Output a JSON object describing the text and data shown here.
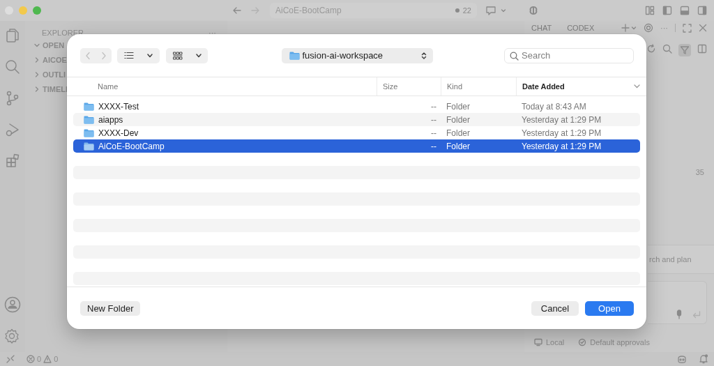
{
  "window": {
    "title": "AiCoE-BootCamp",
    "changes_count": "22"
  },
  "explorer": {
    "title": "EXPLORER",
    "more": "···",
    "sections": [
      {
        "label": "OPEN",
        "expanded": true
      },
      {
        "label": "AICOE",
        "expanded": false
      },
      {
        "label": "OUTLI",
        "expanded": false
      },
      {
        "label": "TIMELI",
        "expanded": false
      }
    ]
  },
  "chat_panel": {
    "tabs": [
      "CHAT",
      "CODEX"
    ],
    "more": "···",
    "filter_active": true,
    "line_count": "35",
    "suggestion": "rch and plan",
    "footer": [
      {
        "kind": "local",
        "label": "Local"
      },
      {
        "kind": "approvals",
        "label": "Default approvals"
      }
    ]
  },
  "status_bar": {
    "errors": "0",
    "warnings": "0"
  },
  "dialog": {
    "location": "fusion-ai-workspace",
    "search": {
      "placeholder": "Search"
    },
    "columns": [
      {
        "label": "Name",
        "sorted": false
      },
      {
        "label": "Size",
        "sorted": false
      },
      {
        "label": "Kind",
        "sorted": false
      },
      {
        "label": "Date Added",
        "sorted": true
      }
    ],
    "rows": [
      {
        "name": "XXXX-Test",
        "size": "--",
        "kind": "Folder",
        "date": "Today at 8:43 AM",
        "selected": false
      },
      {
        "name": "aiapps",
        "size": "--",
        "kind": "Folder",
        "date": "Yesterday at 1:29 PM",
        "selected": false
      },
      {
        "name": "XXXX-Dev",
        "size": "--",
        "kind": "Folder",
        "date": "Yesterday at 1:29 PM",
        "selected": false
      },
      {
        "name": "AiCoE-BootCamp",
        "size": "--",
        "kind": "Folder",
        "date": "Yesterday at 1:29 PM",
        "selected": true
      }
    ],
    "buttons": [
      {
        "label": "New Folder",
        "kind": "secondary"
      },
      {
        "label": "Cancel",
        "kind": "secondary"
      },
      {
        "label": "Open",
        "kind": "primary"
      }
    ]
  }
}
